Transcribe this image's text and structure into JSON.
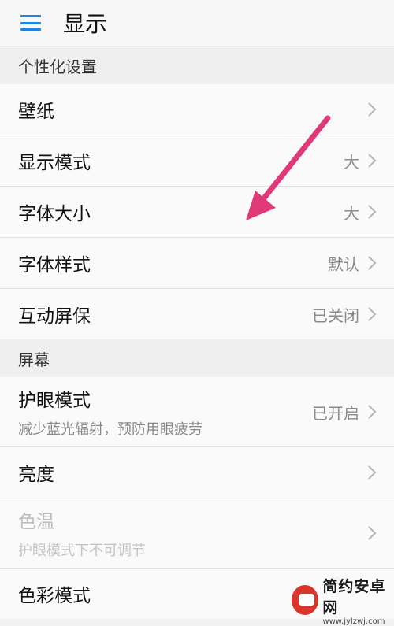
{
  "header": {
    "title": "显示"
  },
  "sections": [
    {
      "title": "个性化设置",
      "rows": [
        {
          "label": "壁纸",
          "value": ""
        },
        {
          "label": "显示模式",
          "value": "大"
        },
        {
          "label": "字体大小",
          "value": "大"
        },
        {
          "label": "字体样式",
          "value": "默认"
        },
        {
          "label": "互动屏保",
          "value": "已关闭"
        }
      ]
    },
    {
      "title": "屏幕",
      "rows": [
        {
          "label": "护眼模式",
          "sub": "减少蓝光辐射，预防用眼疲劳",
          "value": "已开启"
        },
        {
          "label": "亮度",
          "value": ""
        },
        {
          "label": "色温",
          "sub": "护眼模式下不可调节",
          "value": "",
          "disabled": true
        },
        {
          "label": "色彩模式",
          "value": ""
        }
      ]
    }
  ],
  "watermark": {
    "name": "简约安卓网",
    "url": "www.jylzwj.com"
  },
  "colors": {
    "accent": "#1e86e0",
    "annotation_arrow": "#e0397a"
  },
  "icons": [
    "menu-icon",
    "chevron-right-icon"
  ]
}
